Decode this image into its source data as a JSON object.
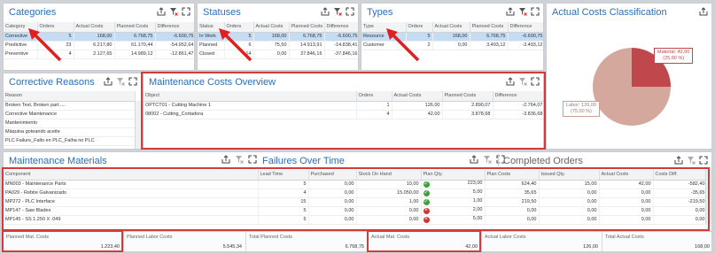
{
  "categories": {
    "title": "Categories",
    "columns": [
      "Category",
      "Orders",
      "Actual Costs",
      "Planned Costs",
      "Difference"
    ],
    "rows": [
      [
        "Corrective",
        "5",
        "168,00",
        "6.768,75",
        "-6.600,75"
      ],
      [
        "Predictive",
        "23",
        "6.217,80",
        "61.170,44",
        "-54.952,64"
      ],
      [
        "Preventive",
        "4",
        "2.127,65",
        "14.989,12",
        "-12.861,47"
      ]
    ]
  },
  "statuses": {
    "title": "Statuses",
    "columns": [
      "Status",
      "Orders",
      "Actual Costs",
      "Planned Costs",
      "Difference"
    ],
    "rows": [
      [
        "In Work",
        "5",
        "168,00",
        "6.768,75",
        "-6.600,75"
      ],
      [
        "Planned",
        "6",
        "75,50",
        "14.913,91",
        "-14.838,41"
      ],
      [
        "Closed",
        "14",
        "0,00",
        "37.846,16",
        "-37.846,16"
      ]
    ]
  },
  "types": {
    "title": "Types",
    "columns": [
      "Type",
      "Orders",
      "Actual Costs",
      "Planned Costs",
      "Difference"
    ],
    "rows": [
      [
        "Resource",
        "5",
        "168,00",
        "6.768,75",
        "-6.600,75"
      ],
      [
        "Customer",
        "2",
        "0,00",
        "3.493,12",
        "-3.493,12"
      ]
    ]
  },
  "classification": {
    "title": "Actual Costs Classification",
    "material_label": "Material: 42,00",
    "material_pct": "(25,00 %)",
    "labor_label": "Labor: 126,00",
    "labor_pct": "(75,00 %)",
    "material_share": 0.25,
    "colors": {
      "material": "#c0474c",
      "labor": "#d5a89e"
    }
  },
  "reasons": {
    "title": "Corrective Reasons",
    "column": "Reason",
    "rows": [
      "Broken Test, Broken part.....",
      "Corrective Maintenance",
      "Mantenimiento",
      "Máquina goteando aceite",
      "PLC Failure_Fallo en PLC_Falha no PLC"
    ]
  },
  "overview": {
    "title": "Maintenance Costs Overview",
    "columns": [
      "Object",
      "Orders",
      "Actual Costs",
      "Planned Costs",
      "Difference"
    ],
    "rows": [
      [
        "OPTCT01 - Cutting Machine 1",
        "1",
        "126,00",
        "2.890,07",
        "-2.764,07"
      ],
      [
        "08002 - Cutting_Cortadora",
        "4",
        "42,00",
        "3.878,68",
        "-3.836,68"
      ]
    ]
  },
  "materials": {
    "title": "Maintenance Materials",
    "tab_failures": "Failures Over Time",
    "tab_completed": "Completed Orders",
    "columns": [
      "Component",
      "Lead Time",
      "Purchased",
      "Stock On Hand",
      "Plan Qty.",
      "Plan Costs",
      "Issued Qty.",
      "Actual Costs",
      "Costs Diff."
    ],
    "rows": [
      {
        "cells": [
          "MN003 - Maintenance Parts",
          "5",
          "0,00",
          "10,00",
          "223,00",
          "624,40",
          "15,00",
          "42,00",
          "-582,40"
        ],
        "status": "ok"
      },
      {
        "cells": [
          "PA029 - Rebite Galvanizado",
          "4",
          "0,00",
          "15.050,00",
          "5,00",
          "35,65",
          "0,00",
          "0,00",
          "-35,65"
        ],
        "status": "ok"
      },
      {
        "cells": [
          "MP272 - PLC Interface",
          "15",
          "0,00",
          "1,00",
          "1,00",
          "219,50",
          "0,00",
          "0,00",
          "-219,50"
        ],
        "status": "ok"
      },
      {
        "cells": [
          "MP147 - Saw Blades",
          "5",
          "0,00",
          "0,00",
          "2,00",
          "0,00",
          "0,00",
          "0,00",
          "0,00"
        ],
        "status": "bad"
      },
      {
        "cells": [
          "MP145 - SS 1.250 X .049",
          "5",
          "0,00",
          "0,00",
          "5,00",
          "0,00",
          "0,00",
          "0,00",
          "0,00"
        ],
        "status": "bad"
      }
    ]
  },
  "summary": [
    {
      "label": "Planned Mat. Costs",
      "value": "1.223,40"
    },
    {
      "label": "Planned Labor Costs",
      "value": "5.545,34"
    },
    {
      "label": "Total Planned Costs",
      "value": "6.768,75"
    },
    {
      "label": "Actual Mat. Costs",
      "value": "42,00"
    },
    {
      "label": "Actual Labor Costs",
      "value": "126,00"
    },
    {
      "label": "Total Actual Costs",
      "value": "168,00"
    }
  ]
}
